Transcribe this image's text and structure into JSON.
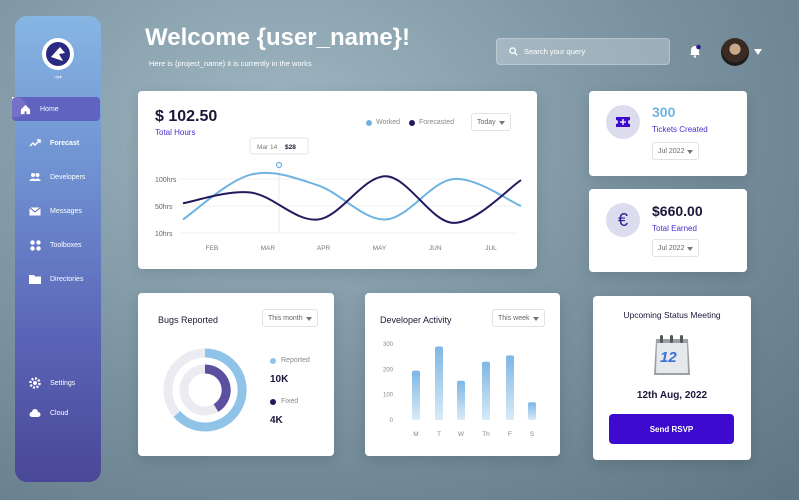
{
  "sidebar": {
    "logo_text": "Ug●",
    "items": [
      {
        "label": "Home",
        "icon": "home-icon"
      },
      {
        "label": "Forecast",
        "icon": "trend-icon"
      },
      {
        "label": "Developers",
        "icon": "people-icon"
      },
      {
        "label": "Messages",
        "icon": "mail-icon"
      },
      {
        "label": "Toolboxes",
        "icon": "grid-icon"
      },
      {
        "label": "Directories",
        "icon": "folder-icon"
      }
    ],
    "bottom_items": [
      {
        "label": "Settings",
        "icon": "gear-icon"
      },
      {
        "label": "Cloud",
        "icon": "cloud-icon"
      }
    ]
  },
  "header": {
    "title": "Welcome {user_name}!",
    "subtitle": "Here is {project_name} it is currently in the works",
    "search_placeholder": "Search your query"
  },
  "hours_card": {
    "value": "$ 102.50",
    "label": "Total Hours",
    "legend_worked": "Worked",
    "legend_forecasted": "Forecasted",
    "period": "Today",
    "tooltip_date": "Mar 14",
    "tooltip_value": "$28",
    "y_ticks": [
      "100hrs",
      "50hrs",
      "10hrs"
    ],
    "x_ticks": [
      "FEB",
      "MAR",
      "APR",
      "MAY",
      "JUN",
      "JUL"
    ]
  },
  "tickets_card": {
    "value": "300",
    "label": "Tickets Created",
    "period": "Jul 2022"
  },
  "earned_card": {
    "value": "$660.00",
    "label": "Total Earned",
    "period": "Jul 2022",
    "symbol": "€"
  },
  "bugs_card": {
    "title": "Bugs Reported",
    "period": "This month",
    "reported_label": "Reported",
    "reported_value": "10K",
    "fixed_label": "Fixed",
    "fixed_value": "4K"
  },
  "activity_card": {
    "title": "Developer Activity",
    "period": "This week"
  },
  "meeting_card": {
    "title": "Upcoming Status Meeting",
    "calendar_day": "12",
    "date": "12th Aug, 2022",
    "button_label": "Send RSVP"
  },
  "colors": {
    "accent": "#3d0ad0",
    "worked": "#6fb3e0",
    "forecasted": "#231a5e"
  },
  "chart_data": [
    {
      "type": "line",
      "x": [
        "FEB",
        "MAR",
        "APR",
        "MAY",
        "JUN",
        "JUL"
      ],
      "yticks": [
        "10hrs",
        "50hrs",
        "100hrs"
      ],
      "series": [
        {
          "name": "Worked",
          "values": [
            30,
            108,
            88,
            30,
            100,
            50
          ]
        },
        {
          "name": "Forecasted",
          "values": [
            55,
            75,
            30,
            105,
            25,
            98
          ]
        }
      ]
    },
    {
      "type": "bar",
      "categories": [
        "M",
        "T",
        "W",
        "Th",
        "F",
        "S"
      ],
      "values": [
        195,
        290,
        155,
        230,
        255,
        70
      ],
      "ylim": [
        0,
        300
      ],
      "yticks": [
        0,
        100,
        200,
        300
      ]
    }
  ]
}
